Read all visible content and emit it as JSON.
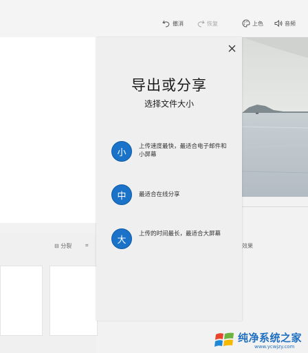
{
  "toolbar": {
    "undo_label": "撤消",
    "redo_label": "恢复",
    "color_label": "上色",
    "audio_label": "音频"
  },
  "dialog": {
    "title": "导出或分享",
    "subtitle": "选择文件大小",
    "options": [
      {
        "badge": "小",
        "text": "上传速度最快，最适合电子邮件和小屏幕"
      },
      {
        "badge": "中",
        "text": "最适合在线分享"
      },
      {
        "badge": "大",
        "text": "上传的时间最长，最适合大屏幕"
      }
    ]
  },
  "editor": {
    "mid_left_label": "分裂",
    "right_label": "效果"
  },
  "watermark": {
    "name": "纯净系统之家",
    "url": "www.ycwjzy.com"
  },
  "colors": {
    "accent": "#1a73c9",
    "panel_bg": "#efefef",
    "watermark": "#1f6fc0"
  }
}
